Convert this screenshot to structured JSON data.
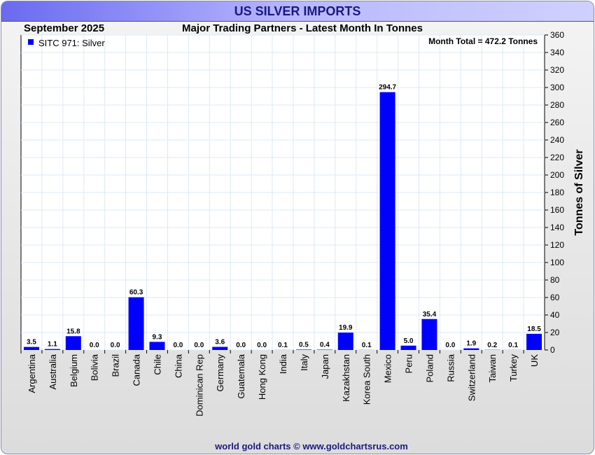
{
  "title": "US SILVER IMPORTS",
  "footer": "world gold charts © www.goldchartsrus.com",
  "chart_data": {
    "type": "bar",
    "title": "Major Trading Partners - Latest Month In Tonnes",
    "period": "September 2025",
    "legend": "SITC 971: Silver",
    "legend_position": "top-left",
    "annotation": "Month Total = 472.2 Tonnes",
    "ylabel": "Tonnes of Silver",
    "xlabel": "",
    "ylim": [
      0,
      360
    ],
    "ytick_step": 20,
    "grid": true,
    "bar_color": "#0000ff",
    "categories": [
      "Argentina",
      "Australia",
      "Belgium",
      "Bolivia",
      "Brazil",
      "Canada",
      "Chile",
      "China",
      "Dominican Rep",
      "Germany",
      "Guatemala",
      "Hong Kong",
      "India",
      "Italy",
      "Japan",
      "Kazakhstan",
      "Korea South",
      "Mexico",
      "Peru",
      "Poland",
      "Russia",
      "Switzerland",
      "Taiwan",
      "Turkey",
      "UK"
    ],
    "values": [
      3.5,
      1.1,
      15.8,
      0.0,
      0.0,
      60.3,
      9.3,
      0.0,
      0.0,
      3.6,
      0.0,
      0.0,
      0.1,
      0.5,
      0.4,
      19.9,
      0.1,
      294.7,
      5.0,
      35.4,
      0.0,
      1.9,
      0.2,
      0.1,
      18.5
    ]
  }
}
